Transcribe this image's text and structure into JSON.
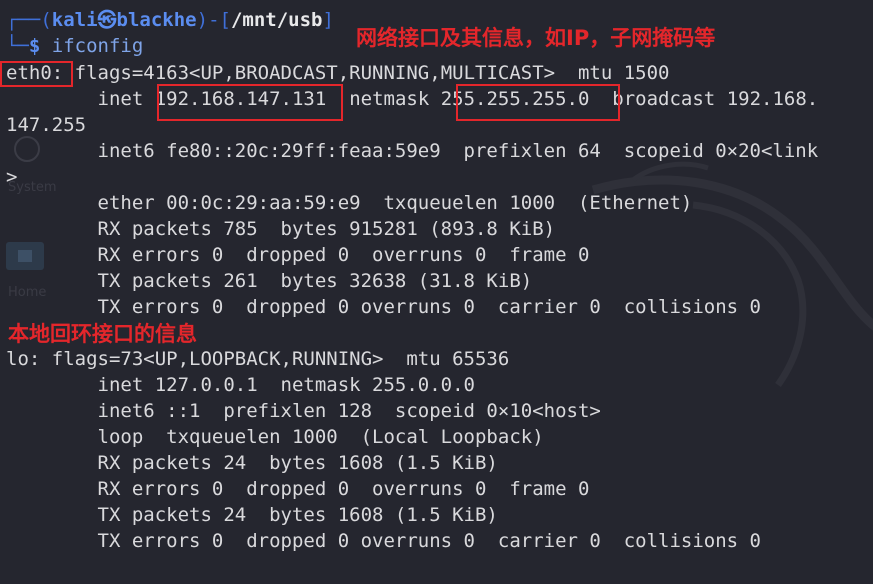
{
  "prompt": {
    "top_line_prefix": "┌──(",
    "user": "kali",
    "separator": "㉿",
    "host": "blackhe",
    "mid": ")-[",
    "path": "/mnt/usb",
    "end": "]",
    "second_line_prefix": "└─",
    "dollar": "$",
    "command": "ifconfig"
  },
  "annotations": {
    "eth0_note": "网络接口及其信息，如IP，子网掩码等",
    "lo_note": "本地回环接口的信息"
  },
  "background_ghost": {
    "system_label": "System",
    "home_label": "Home"
  },
  "output_lines": [
    {
      "id": "eth0-header-name",
      "text": "eth0:"
    },
    {
      "id": "eth0-header-rest",
      "text": " flags=4163<UP,BROADCAST,RUNNING,MULTICAST>  mtu 1500"
    },
    {
      "id": "eth0-inet-label",
      "text": "        inet "
    },
    {
      "id": "eth0-inet-ip",
      "text": "192.168.147.131"
    },
    {
      "id": "eth0-netmask-label",
      "text": "  netmask "
    },
    {
      "id": "eth0-netmask",
      "text": "255.255.255.0"
    },
    {
      "id": "eth0-broadcast",
      "text": "  broadcast 192.168."
    },
    {
      "id": "eth0-broadcast-wrap",
      "text": "147.255"
    },
    {
      "id": "eth0-inet6",
      "text": "        inet6 fe80::20c:29ff:feaa:59e9  prefixlen 64  scopeid 0×20<link"
    },
    {
      "id": "eth0-inet6-wrap",
      "text": ">"
    },
    {
      "id": "eth0-ether",
      "text": "        ether 00:0c:29:aa:59:e9  txqueuelen 1000  (Ethernet)"
    },
    {
      "id": "eth0-rx-packets",
      "text": "        RX packets 785  bytes 915281 (893.8 KiB)"
    },
    {
      "id": "eth0-rx-errors",
      "text": "        RX errors 0  dropped 0  overruns 0  frame 0"
    },
    {
      "id": "eth0-tx-packets",
      "text": "        TX packets 261  bytes 32638 (31.8 KiB)"
    },
    {
      "id": "eth0-tx-errors",
      "text": "        TX errors 0  dropped 0 overruns 0  carrier 0  collisions 0"
    },
    {
      "id": "lo-header",
      "text": "lo: flags=73<UP,LOOPBACK,RUNNING>  mtu 65536"
    },
    {
      "id": "lo-inet",
      "text": "        inet 127.0.0.1  netmask 255.0.0.0"
    },
    {
      "id": "lo-inet6",
      "text": "        inet6 ::1  prefixlen 128  scopeid 0×10<host>"
    },
    {
      "id": "lo-loop",
      "text": "        loop  txqueuelen 1000  (Local Loopback)"
    },
    {
      "id": "lo-rx-packets",
      "text": "        RX packets 24  bytes 1608 (1.5 KiB)"
    },
    {
      "id": "lo-rx-errors",
      "text": "        RX errors 0  dropped 0  overruns 0  frame 0"
    },
    {
      "id": "lo-tx-packets",
      "text": "        TX packets 24  bytes 1608 (1.5 KiB)"
    },
    {
      "id": "lo-tx-errors",
      "text": "        TX errors 0  dropped 0 overruns 0  carrier 0  collisions 0"
    }
  ],
  "colors": {
    "background": "#25262f",
    "text": "#d9d9dc",
    "prompt_blue": "#5b8df0",
    "annotation_red": "#e4262b"
  }
}
